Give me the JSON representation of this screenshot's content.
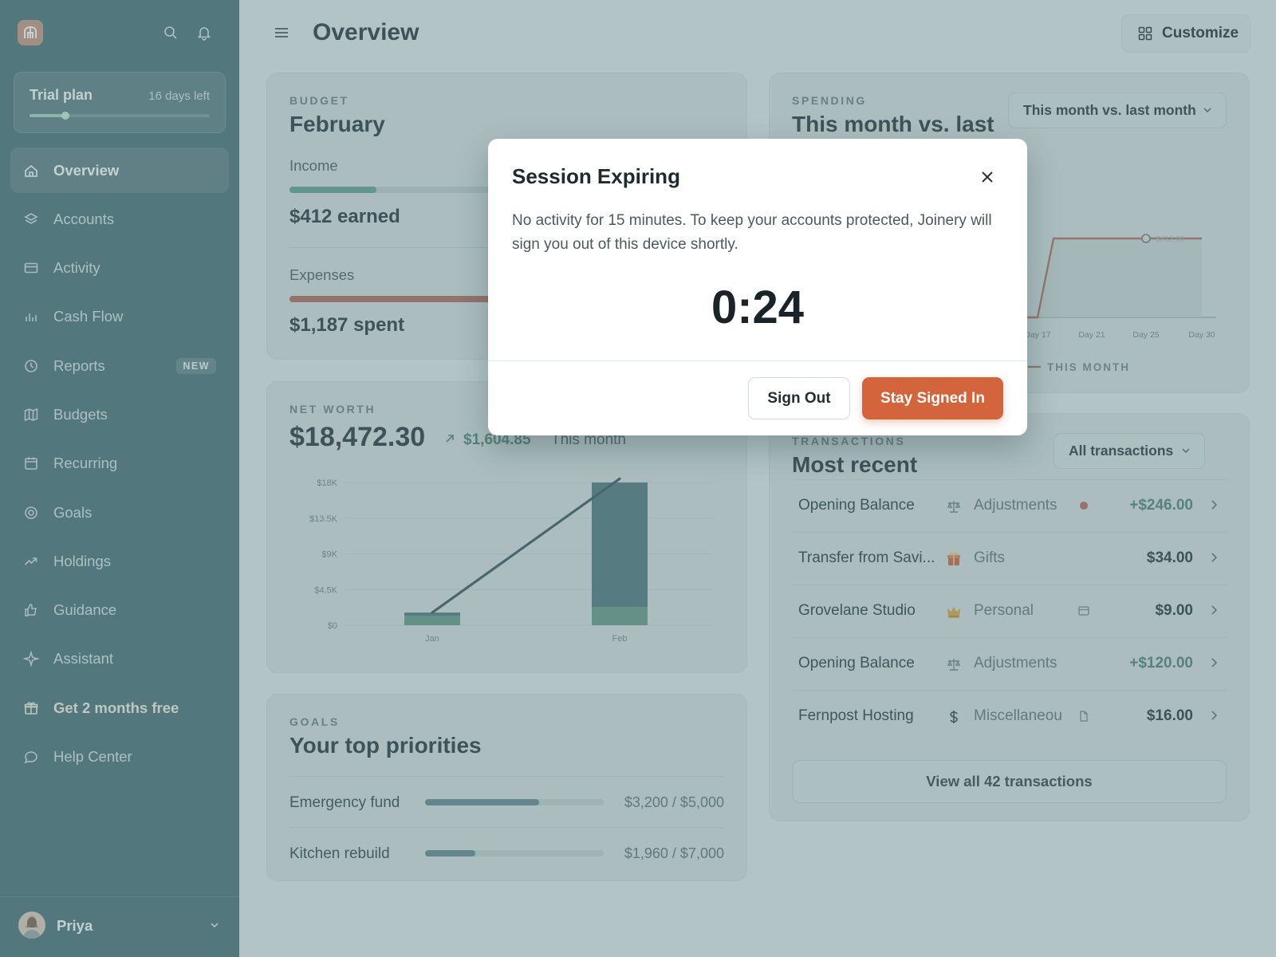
{
  "sidebar": {
    "trial": {
      "title": "Trial plan",
      "days_left": "16 days left",
      "progress": 0.2
    },
    "nav": [
      {
        "label": "Overview",
        "icon": "home-icon",
        "active": true
      },
      {
        "label": "Accounts",
        "icon": "layers-icon"
      },
      {
        "label": "Activity",
        "icon": "credit-card-icon"
      },
      {
        "label": "Cash Flow",
        "icon": "bar-chart-icon"
      },
      {
        "label": "Reports",
        "icon": "clock-icon",
        "badge": "NEW"
      },
      {
        "label": "Budgets",
        "icon": "map-icon"
      },
      {
        "label": "Recurring",
        "icon": "calendar-icon"
      },
      {
        "label": "Goals",
        "icon": "target-icon"
      },
      {
        "label": "Holdings",
        "icon": "trending-up-icon"
      },
      {
        "label": "Guidance",
        "icon": "thumbs-up-icon"
      },
      {
        "label": "Assistant",
        "icon": "sparkle-icon"
      },
      {
        "label": "Get 2 months free",
        "icon": "gift-icon"
      },
      {
        "label": "Help Center",
        "icon": "chat-bubble-icon"
      }
    ],
    "user": {
      "name": "Priya"
    }
  },
  "header": {
    "title": "Overview",
    "customize_label": "Customize"
  },
  "budget": {
    "eyebrow": "BUDGET",
    "title": "February",
    "income_label": "Income",
    "income_value": "$412 earned",
    "income_progress": 0.2,
    "expenses_label": "Expenses",
    "expenses_value": "$1,187 spent",
    "expenses_progress": 0.58
  },
  "spending": {
    "eyebrow": "SPENDING",
    "title": "This month vs. last",
    "dropdown": "This month vs. last month",
    "legend": "THIS MONTH",
    "point_label": "$412.00"
  },
  "net_worth": {
    "eyebrow": "NET WORTH",
    "value": "$18,472.30",
    "change": "$1,604.85",
    "change_period": "This month"
  },
  "goals": {
    "eyebrow": "GOALS",
    "title": "Your top priorities",
    "items": [
      {
        "name": "Emergency fund",
        "amount": "$3,200 / $5,000",
        "progress": 0.64
      },
      {
        "name": "Kitchen rebuild",
        "amount": "$1,960 / $7,000",
        "progress": 0.28
      }
    ]
  },
  "transactions": {
    "eyebrow": "TRANSACTIONS",
    "title": "Most recent",
    "filter": "All transactions",
    "rows": [
      {
        "name": "Opening Balance",
        "category": "Adjustments",
        "category_icon": "scale-icon",
        "flag": "dot",
        "amount": "+$246.00",
        "positive": true
      },
      {
        "name": "Transfer from Savi...",
        "category": "Gifts",
        "category_icon": "gift-emoji-icon",
        "flag": "",
        "amount": "$34.00",
        "positive": false
      },
      {
        "name": "Grovelane Studio",
        "category": "Personal",
        "category_icon": "crown-icon",
        "flag": "card",
        "amount": "$9.00",
        "positive": false
      },
      {
        "name": "Opening Balance",
        "category": "Adjustments",
        "category_icon": "scale-icon",
        "flag": "",
        "amount": "+$120.00",
        "positive": true
      },
      {
        "name": "Fernpost Hosting",
        "category": "Miscellaneou",
        "category_icon": "dollar-icon",
        "flag": "file",
        "amount": "$16.00",
        "positive": false
      }
    ],
    "view_all": "View all 42 transactions"
  },
  "chart_data": [
    {
      "type": "bar",
      "title": "",
      "categories": [
        "Jan",
        "Feb"
      ],
      "yticks": [
        "$18K",
        "$13.5K",
        "$9K",
        "$4.5K",
        "$0"
      ],
      "ylim": [
        0,
        18000
      ],
      "series": [
        {
          "values": [
            1200,
            2300
          ],
          "color": "#6f9f8f"
        },
        {
          "values": [
            400,
            15700
          ],
          "color": "#5e8188"
        }
      ],
      "line": {
        "values": [
          1600,
          18472
        ]
      }
    },
    {
      "type": "line",
      "title": "",
      "x_ticks": [
        "Day 17",
        "Day 21",
        "Day 25",
        "Day 30"
      ],
      "series": [
        {
          "name": "THIS MONTH",
          "values": [
            0,
            412,
            412,
            412
          ]
        }
      ]
    }
  ],
  "modal": {
    "title": "Session Expiring",
    "body": "No activity for 15 minutes. To keep your accounts protected, Joinery will sign you out of this device shortly.",
    "timer": "0:24",
    "sign_out": "Sign Out",
    "stay": "Stay Signed In"
  },
  "colors": {
    "accent": "#d4643b",
    "sidebar": "#587a80",
    "positive": "#5e8a7e"
  }
}
